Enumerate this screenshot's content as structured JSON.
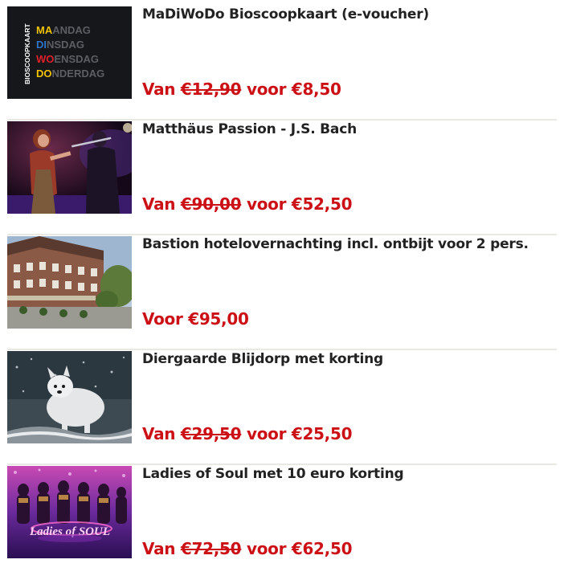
{
  "accent_color": "#cc1116",
  "items": [
    {
      "title": "MaDiWoDo Bioscoopkaart (e-voucher)",
      "price_prefix": "Van",
      "old_price": "€12,90",
      "price_joiner": "voor",
      "new_price": "€8,50",
      "image": {
        "vertical_text": "BIOSCOOPKAART",
        "lines": [
          {
            "highlight": "MA",
            "rest": "ANDAG",
            "color": "#f3c300"
          },
          {
            "highlight": "DI",
            "rest": "NSDAG",
            "color": "#2f74c8"
          },
          {
            "highlight": "WO",
            "rest": "ENSDAG",
            "color": "#e3202a"
          },
          {
            "highlight": "DO",
            "rest": "NDERDAG",
            "color": "#f3c300"
          }
        ]
      }
    },
    {
      "title": "Matthäus Passion - J.S. Bach",
      "price_prefix": "Van",
      "old_price": "€90,00",
      "price_joiner": "voor",
      "new_price": "€52,50",
      "image": {
        "icon": "concert-photo"
      }
    },
    {
      "title": "Bastion hotelovernachting incl. ontbijt voor 2 pers.",
      "price_prefix": "Voor",
      "old_price": "",
      "price_joiner": "",
      "new_price": "€95,00",
      "image": {
        "icon": "hotel-photo"
      }
    },
    {
      "title": "Diergaarde Blijdorp met korting",
      "price_prefix": "Van",
      "old_price": "€29,50",
      "price_joiner": "voor",
      "new_price": "€25,50",
      "image": {
        "icon": "arctic-fox-photo"
      }
    },
    {
      "title": "Ladies of Soul met 10 euro korting",
      "price_prefix": "Van",
      "old_price": "€72,50",
      "price_joiner": "voor",
      "new_price": "€62,50",
      "image": {
        "logo_text": "Ladies of SOUL"
      }
    }
  ]
}
